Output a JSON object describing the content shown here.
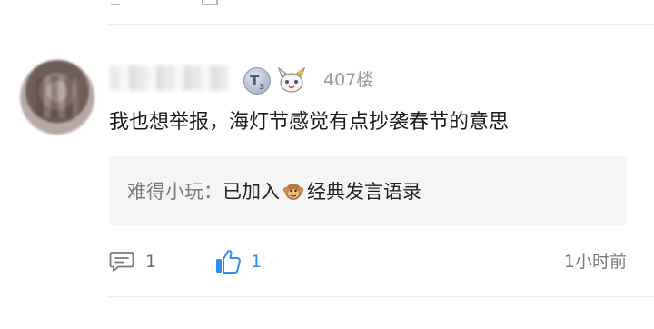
{
  "post": {
    "floor": "407楼",
    "badge_letter": "T",
    "badge_level": "3",
    "content": "我也想举报，海灯节感觉有点抄袭春节的意思",
    "quote": {
      "user": "难得小玩",
      "separator": "：",
      "prefix": "已加入",
      "suffix": "经典发言语录"
    },
    "comment_count": "1",
    "like_count": "1",
    "time": "1小时前"
  },
  "icons": [
    "comment-icon",
    "like-icon",
    "monkey-emoji",
    "mascot-badge-icon",
    "level-badge-icon"
  ],
  "colors": {
    "like_blue": "#2e8ef2",
    "quote_bg": "#f5f5f6",
    "meta_gray": "#9c9c9c"
  }
}
